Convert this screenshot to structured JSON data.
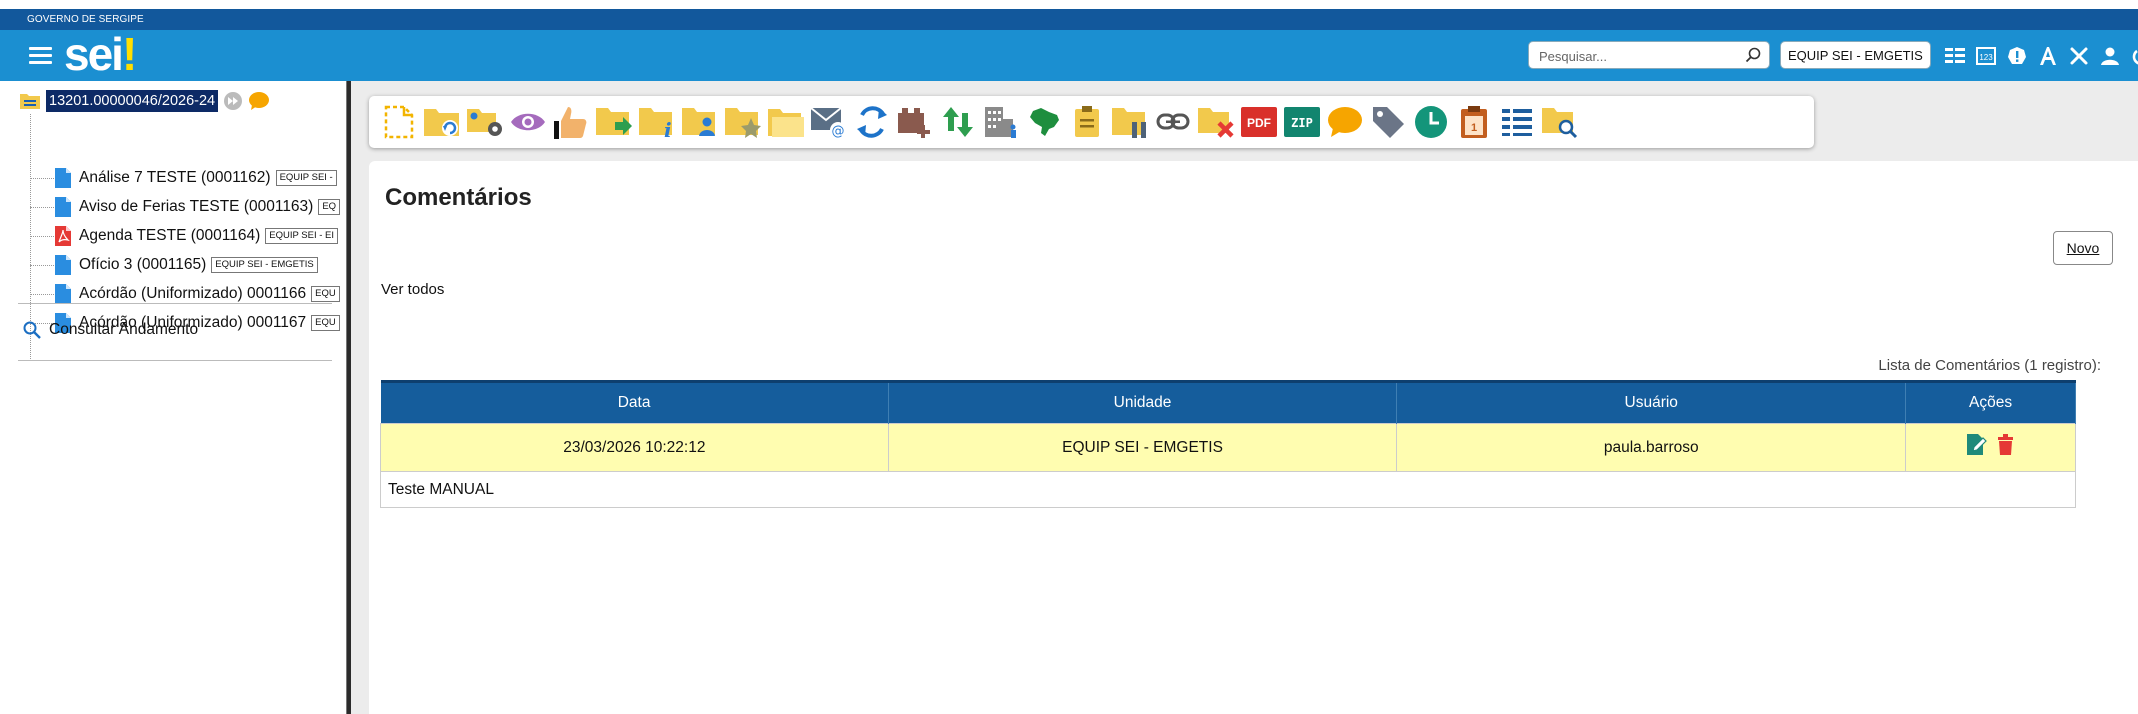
{
  "header": {
    "gov_label": "GOVERNO DE SERGIPE",
    "logo_text": "sei",
    "logo_bang": "!",
    "search_placeholder": "Pesquisar...",
    "unit": "EQUIP SEI - EMGETIS",
    "icons": [
      "list-icon",
      "keypad-icon",
      "alert-icon",
      "font-size-icon",
      "tools-icon",
      "user-icon",
      "power-icon"
    ]
  },
  "tree": {
    "process_number": "13201.00000046/2026-24",
    "documents": [
      {
        "label": "Análise 7 TESTE (0001162)",
        "unit": "EQUIP SEI -",
        "type": "doc"
      },
      {
        "label": "Aviso de Ferias TESTE (0001163)",
        "unit": "EQ",
        "type": "doc"
      },
      {
        "label": "Agenda TESTE (0001164)",
        "unit": "EQUIP SEI - EI",
        "type": "pdf"
      },
      {
        "label": "Ofício 3 (0001165)",
        "unit": "EQUIP SEI - EMGETIS",
        "type": "doc"
      },
      {
        "label": "Acórdão (Uniformizado) 0001166",
        "unit": "EQU",
        "type": "doc"
      },
      {
        "label": "Acórdão (Uniformizado) 0001167",
        "unit": "EQU",
        "type": "doc"
      }
    ],
    "consultar_andamento": "Consultar Andamento"
  },
  "toolbar": {
    "buttons": [
      "new-document-icon",
      "reopen-process-icon",
      "process-settings-icon",
      "view-icon",
      "attention-icon",
      "send-process-icon",
      "process-info-icon",
      "assign-process-icon",
      "follow-up-icon",
      "related-processes-icon",
      "email-icon",
      "relationship-icon",
      "add-block-icon",
      "sort-icon",
      "organization-icon",
      "brazil-map-icon",
      "note-icon",
      "suspend-icon",
      "link-icon",
      "cancel-process-icon",
      "pdf-icon",
      "zip-icon",
      "comment-icon",
      "tag-icon",
      "clock-icon",
      "clipboard-icon",
      "list-view-icon",
      "search-folder-icon"
    ],
    "pdf_text": "PDF",
    "zip_text": "ZIP"
  },
  "content": {
    "title": "Comentários",
    "novo_label": "Novo",
    "ver_todos": "Ver todos",
    "caption": "Lista de Comentários (1 registro):",
    "columns": [
      "Data",
      "Unidade",
      "Usuário",
      "Ações"
    ],
    "rows": [
      {
        "data": "23/03/2026 10:22:12",
        "unidade": "EQUIP SEI - EMGETIS",
        "usuario": "paula.barroso",
        "comentario": "Teste MANUAL"
      }
    ]
  },
  "colors": {
    "gov_bar": "#12589c",
    "header": "#1b8fd1",
    "table_header": "#155d9c",
    "row_highlight": "#fffdb0",
    "folder": "#f2c94c",
    "logo_accent": "#ffdf00"
  }
}
